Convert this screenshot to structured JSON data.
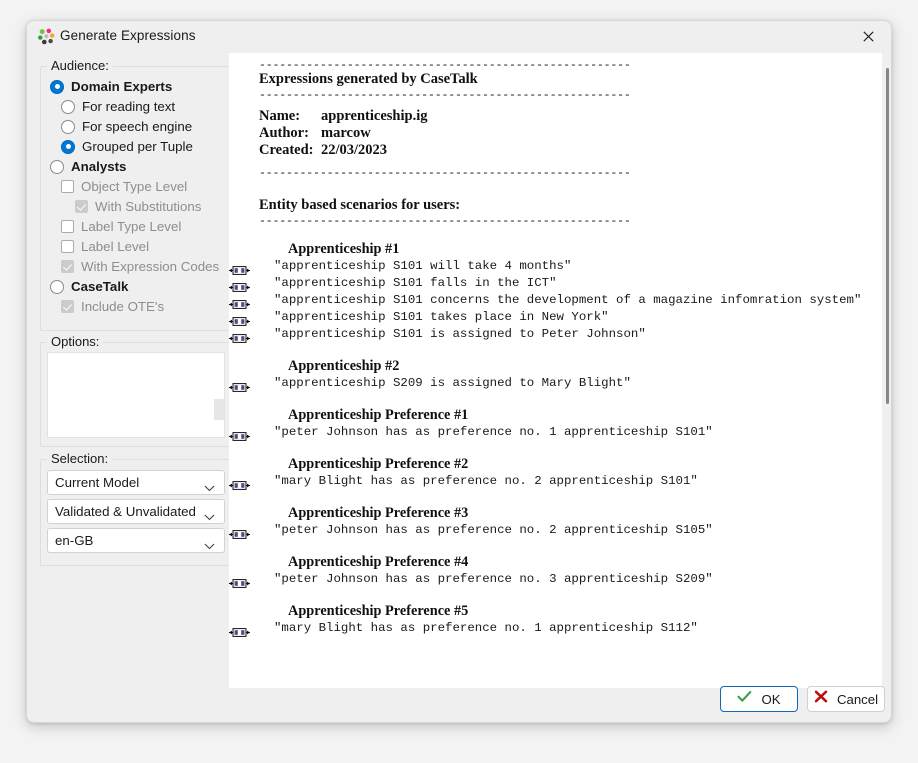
{
  "window": {
    "title": "Generate Expressions",
    "logo_icon": "casetalk-dots-logo-icon",
    "close_icon": "close-icon"
  },
  "sidebar": {
    "audience": {
      "legend": "Audience:",
      "items": [
        {
          "label": "Domain Experts",
          "control": "radio",
          "state": "checked",
          "indent": 0,
          "disabled": false
        },
        {
          "label": "For reading text",
          "control": "radio",
          "state": "unchecked",
          "indent": 1,
          "disabled": false
        },
        {
          "label": "For speech engine",
          "control": "radio",
          "state": "unchecked",
          "indent": 1,
          "disabled": false
        },
        {
          "label": "Grouped per Tuple",
          "control": "radio",
          "state": "checked",
          "indent": 1,
          "disabled": false
        },
        {
          "label": "Analysts",
          "control": "radio",
          "state": "unchecked",
          "indent": 0,
          "disabled": false
        },
        {
          "label": "Object Type Level",
          "control": "checkbox",
          "state": "unchecked",
          "indent": 1,
          "disabled": true
        },
        {
          "label": "With Substitutions",
          "control": "checkbox",
          "state": "checked-disabled",
          "indent": 2,
          "disabled": true
        },
        {
          "label": "Label Type Level",
          "control": "checkbox",
          "state": "unchecked",
          "indent": 1,
          "disabled": true
        },
        {
          "label": "Label Level",
          "control": "checkbox",
          "state": "unchecked",
          "indent": 1,
          "disabled": true
        },
        {
          "label": "With Expression Codes",
          "control": "checkbox",
          "state": "checked-disabled",
          "indent": 1,
          "disabled": true
        },
        {
          "label": "CaseTalk",
          "control": "radio",
          "state": "unchecked",
          "indent": 0,
          "disabled": false
        },
        {
          "label": "Include OTE's",
          "control": "checkbox",
          "state": "checked-disabled",
          "indent": 1,
          "disabled": true
        }
      ]
    },
    "options": {
      "legend": "Options:",
      "content": ""
    },
    "selection": {
      "legend": "Selection:",
      "dropdowns": [
        {
          "name": "model-scope",
          "value": "Current Model"
        },
        {
          "name": "validation-filter",
          "value": "Validated & Unvalidated"
        },
        {
          "name": "language",
          "value": "en-GB"
        }
      ]
    }
  },
  "document": {
    "rule": "-------------------------------------------------------",
    "title": "Expressions generated by CaseTalk",
    "meta": [
      {
        "key": "Name:",
        "value": "apprenticeship.ig"
      },
      {
        "key": "Author:",
        "value": "marcow"
      },
      {
        "key": "Created:",
        "value": "22/03/2023"
      }
    ],
    "section_heading": "Entity based scenarios for users:",
    "expression_icon": "expression-sentence-icon",
    "groups": [
      {
        "title": "Apprenticeship #1",
        "expressions": [
          "\"apprenticeship S101 will take 4 months\"",
          "\"apprenticeship S101 falls in the ICT\"",
          "\"apprenticeship S101 concerns the development of a magazine infomration system\"",
          "\"apprenticeship S101 takes place in New York\"",
          "\"apprenticeship S101 is assigned to Peter Johnson\""
        ]
      },
      {
        "title": "Apprenticeship #2",
        "expressions": [
          "\"apprenticeship S209 is assigned to Mary Blight\""
        ]
      },
      {
        "title": "Apprenticeship Preference #1",
        "expressions": [
          "\"peter Johnson has as preference no. 1 apprenticeship S101\""
        ]
      },
      {
        "title": "Apprenticeship Preference #2",
        "expressions": [
          "\"mary Blight has as preference no. 2 apprenticeship S101\""
        ]
      },
      {
        "title": "Apprenticeship Preference #3",
        "expressions": [
          "\"peter Johnson has as preference no. 2 apprenticeship S105\""
        ]
      },
      {
        "title": "Apprenticeship Preference #4",
        "expressions": [
          "\"peter Johnson has as preference no. 3 apprenticeship S209\""
        ]
      },
      {
        "title": "Apprenticeship Preference #5",
        "expressions": [
          "\"mary Blight has as preference no. 1 apprenticeship S112\""
        ]
      }
    ]
  },
  "footer": {
    "ok_label": "OK",
    "ok_icon": "green-check-icon",
    "cancel_label": "Cancel",
    "cancel_icon": "red-cross-icon"
  },
  "colors": {
    "accent": "#0078d4",
    "ok_check": "#3f9e4d",
    "cancel_cross": "#c10b0b",
    "window_bg": "#efefef",
    "content_bg": "#ffffff"
  }
}
